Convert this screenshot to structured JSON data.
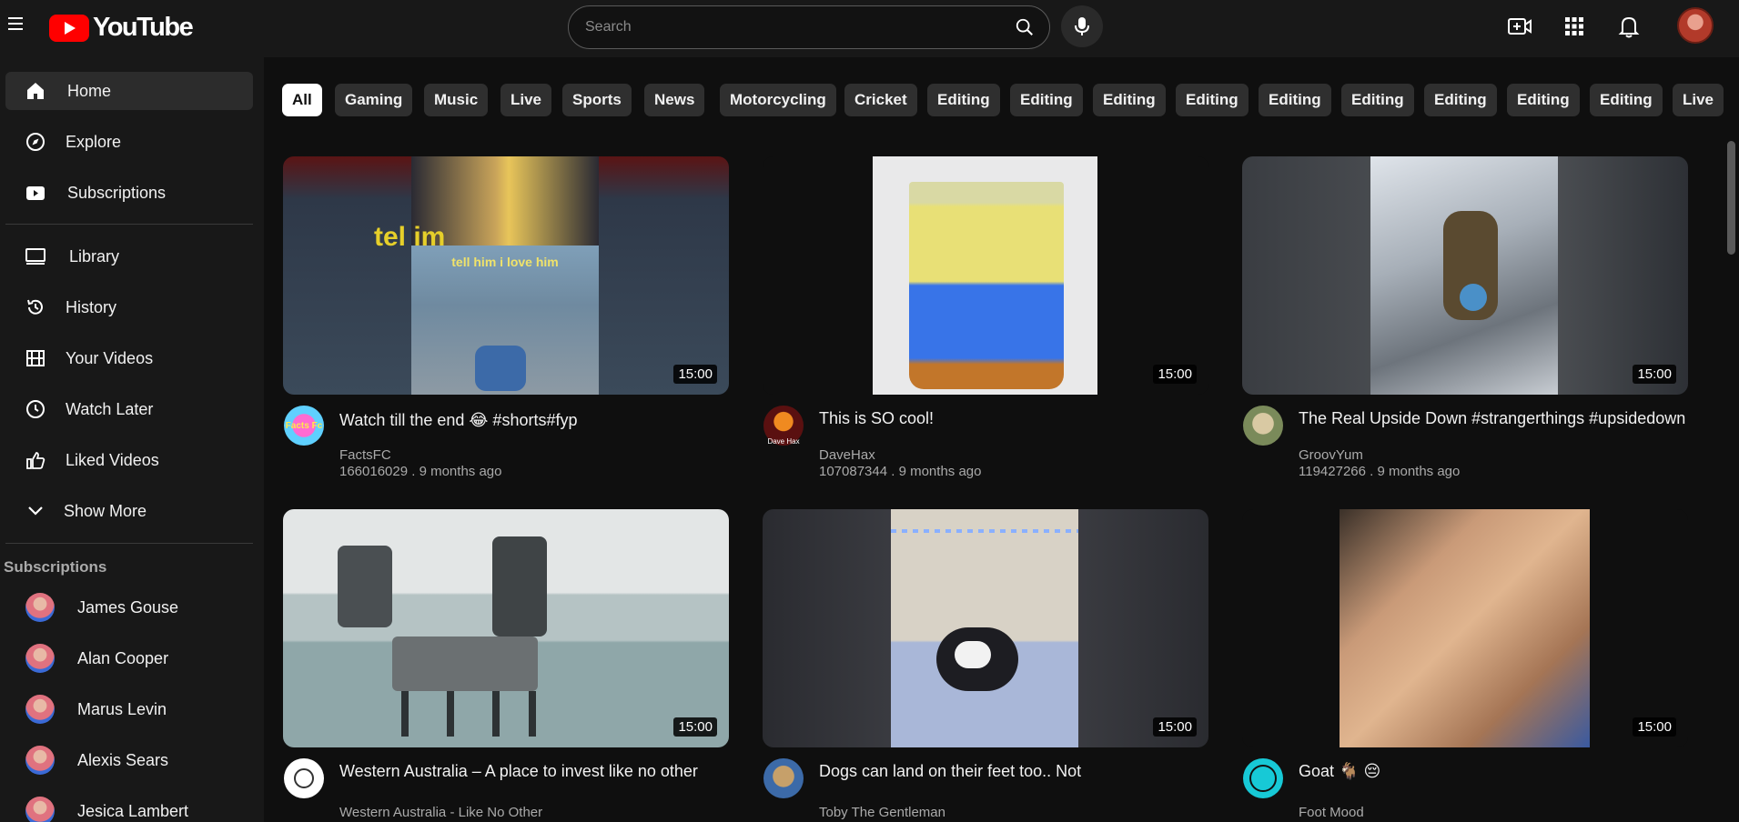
{
  "header": {
    "logo_text": "YouTube",
    "search_placeholder": "Search",
    "icons": [
      "menu-icon",
      "youtube-logo",
      "search-icon",
      "mic-icon",
      "create-video-icon",
      "apps-grid-icon",
      "notifications-bell-icon",
      "user-avatar"
    ]
  },
  "sidebar": {
    "items": [
      {
        "label": "Home",
        "icon": "home-icon",
        "active": true
      },
      {
        "label": "Explore",
        "icon": "compass-icon"
      },
      {
        "label": "Subscriptions",
        "icon": "subscriptions-icon"
      },
      {
        "label": "Library",
        "icon": "library-icon"
      },
      {
        "label": "History",
        "icon": "history-icon"
      },
      {
        "label": "Your Videos",
        "icon": "your-videos-icon"
      },
      {
        "label": "Watch Later",
        "icon": "clock-icon"
      },
      {
        "label": "Liked Videos",
        "icon": "thumbs-up-icon"
      },
      {
        "label": "Show More",
        "icon": "chevron-down-icon"
      }
    ],
    "subscriptions_heading": "Subscriptions",
    "subscriptions": [
      {
        "name": "James Gouse"
      },
      {
        "name": "Alan Cooper"
      },
      {
        "name": "Marus Levin"
      },
      {
        "name": "Alexis Sears"
      },
      {
        "name": "Jesica Lambert"
      }
    ]
  },
  "chips": [
    "All",
    "Gaming",
    "Music",
    "Live",
    "Sports",
    "News",
    "Motorcycling",
    "Cricket",
    "Editing",
    "Editing",
    "Editing",
    "Editing",
    "Editing",
    "Editing",
    "Editing",
    "Editing",
    "Editing",
    "Live"
  ],
  "videos": [
    {
      "title": "Watch till the end 😂 #shorts#fyp",
      "channel": "FactsFC",
      "meta": "166016029 . 9 months ago",
      "duration": "15:00",
      "thumb_caption": "tell him i love him",
      "thumb_caption_bg": "tel          im"
    },
    {
      "title": "This is SO cool!",
      "channel": "DaveHax",
      "meta": "107087344 . 9 months ago",
      "duration": "15:00"
    },
    {
      "title": "The Real Upside Down #strangerthings #upsidedown",
      "channel": "GroovYum",
      "meta": "119427266 . 9 months ago",
      "duration": "15:00"
    },
    {
      "title": "Western Australia – A place to invest like no other",
      "channel": "Western Australia - Like No Other",
      "meta": "",
      "duration": "15:00"
    },
    {
      "title": "Dogs can land on their feet too.. Not",
      "channel": "Toby The Gentleman",
      "meta": "",
      "duration": "15:00"
    },
    {
      "title": "Goat 🐐 😔",
      "channel": "Foot Mood",
      "meta": "",
      "duration": "15:00"
    }
  ],
  "avatar_labels": {
    "factsfc": "Facts Fc",
    "davehax": "Dave Hax"
  },
  "colors": {
    "background": "#0f0f0f",
    "surface": "#181818",
    "chip": "#2f2f2f",
    "brand_red": "#ff0000"
  }
}
